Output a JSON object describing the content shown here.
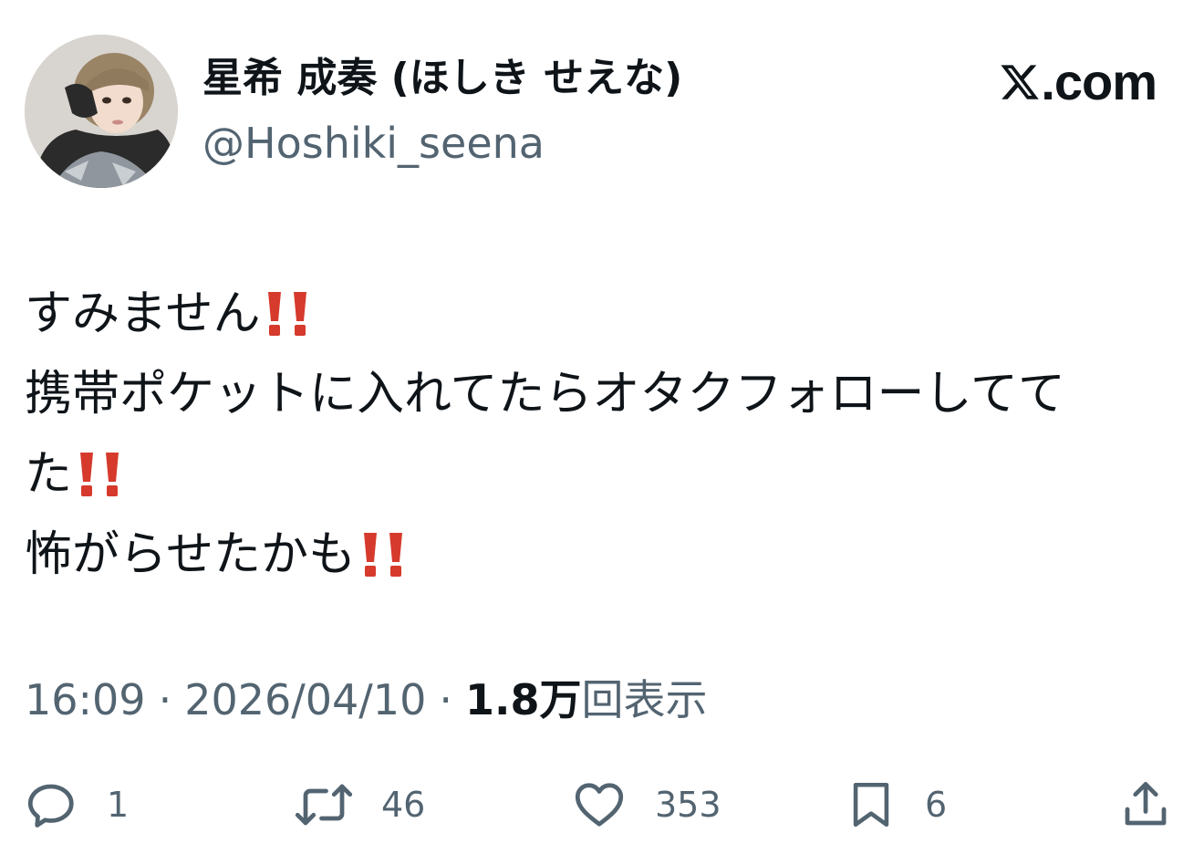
{
  "author": {
    "display_name": "星希 成奏 (ほしき せえな)",
    "handle": "@Hoshiki_seena"
  },
  "brand": {
    "text": ".com",
    "logo_icon": "x-logo-icon"
  },
  "tweet": {
    "lines": [
      "すみません",
      "携帯ポケットに入れてたらオタクフォローしてて",
      "た",
      "怖がらせたかも"
    ],
    "emoji": "double-exclamation-icon"
  },
  "meta": {
    "time": "16:09",
    "separator": "·",
    "date": "2026/04/10",
    "views_count": "1.8万",
    "views_label": "回表示"
  },
  "actions": {
    "replies": "1",
    "retweets": "46",
    "likes": "353",
    "bookmarks": "6"
  },
  "colors": {
    "text_primary": "#0f1419",
    "text_secondary": "#536471",
    "emoji_red": "#d63a2c"
  }
}
